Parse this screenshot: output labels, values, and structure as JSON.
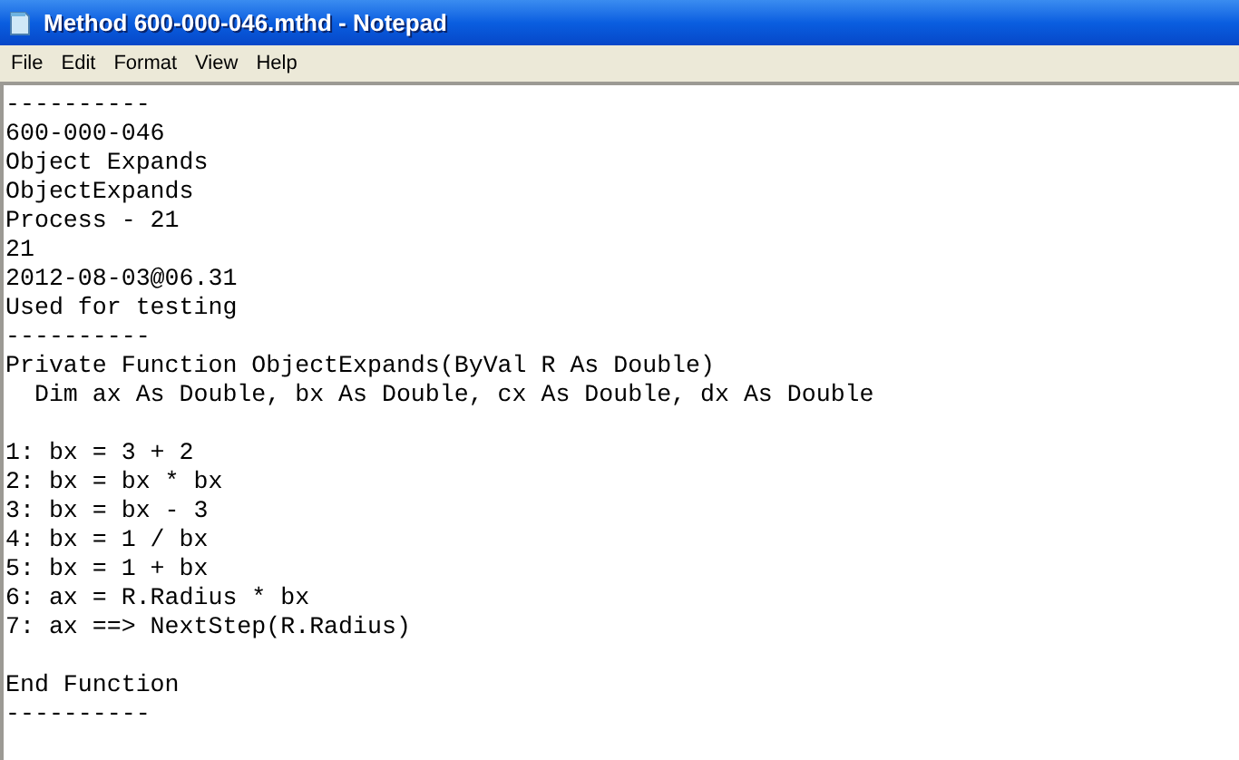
{
  "window": {
    "title": "Method 600-000-046.mthd - Notepad"
  },
  "menu": [
    "File",
    "Edit",
    "Format",
    "View",
    "Help"
  ],
  "editor": {
    "blocks": [
      [
        "----------",
        "600-000-046",
        "Object Expands",
        "ObjectExpands",
        "Process - 21",
        "21",
        "2012-08-03@06.31",
        "Used for testing",
        "----------",
        "Private Function ObjectExpands(ByVal R As Double)",
        "  Dim ax As Double, bx As Double, cx As Double, dx As Double"
      ],
      [
        "1: bx = 3 + 2",
        "2: bx = bx * bx",
        "3: bx = bx - 3",
        "4: bx = 1 / bx",
        "5: bx = 1 + bx",
        "6: ax = R.Radius * bx",
        "7: ax ==> NextStep(R.Radius)"
      ],
      [
        "End Function",
        "----------"
      ]
    ]
  }
}
